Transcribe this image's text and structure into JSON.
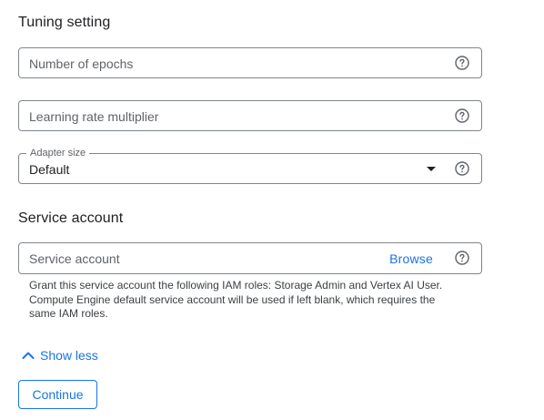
{
  "tuning": {
    "title": "Tuning setting",
    "epochs_placeholder": "Number of epochs",
    "lr_placeholder": "Learning rate multiplier",
    "adapter_label": "Adapter size",
    "adapter_value": "Default"
  },
  "service": {
    "title": "Service account",
    "placeholder": "Service account",
    "browse_label": "Browse",
    "hint": "Grant this service account the following IAM roles: Storage Admin and Vertex AI User. Compute Engine default service account will be used if left blank, which requires the same IAM roles."
  },
  "actions": {
    "show_less_label": "Show less",
    "continue_label": "Continue"
  },
  "colors": {
    "accent": "#1a73e8",
    "border": "#80868b",
    "help_icon": "#5f6368"
  },
  "icons": {
    "help": "help-circle-icon",
    "dropdown": "caret-down-icon",
    "collapse": "chevron-up-icon"
  }
}
